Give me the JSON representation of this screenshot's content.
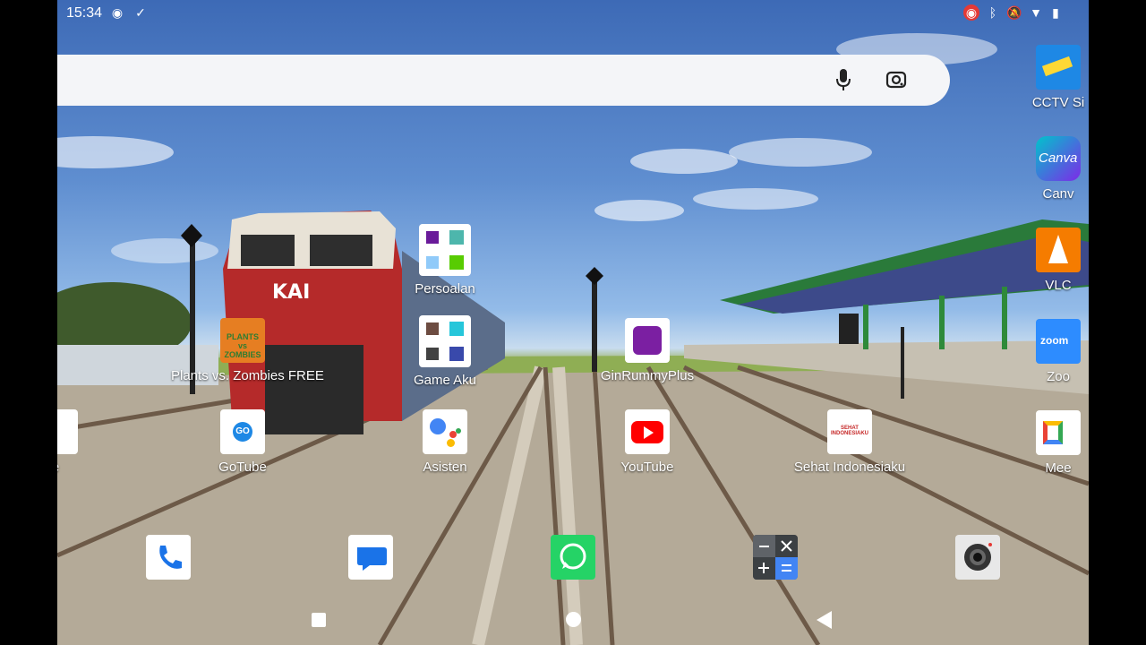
{
  "status_bar": {
    "time": "15:34"
  },
  "search_bar": {
    "placeholder": ""
  },
  "apps": {
    "cctv": "CCTV Si",
    "canva": "Canv",
    "vlc": "VLC",
    "persoalan": "Persoalan",
    "plants": "Plants vs. Zombies FREE",
    "game_aku": "Game Aku",
    "ginrummy": "GinRummyPlus",
    "zoom": "Zoo",
    "partial_left": "e",
    "gotube": "GoTube",
    "asisten": "Asisten",
    "youtube": "YouTube",
    "sehat": "Sehat Indonesiaku",
    "meet": "Mee"
  },
  "icon_text": {
    "plants": "PLANTS vs ZOMBIES",
    "gotube": "GO",
    "sehat": "SEHAT INDONESIAKU",
    "canva": "Canva",
    "zoom": "zoom"
  },
  "dock": [
    "phone-icon",
    "messages-icon",
    "whatsapp-icon",
    "calculator-icon",
    "camera-icon"
  ],
  "colors": {
    "youtube_red": "#ff0000",
    "whatsapp_green": "#25d366",
    "sky": "#5f8ed0"
  }
}
